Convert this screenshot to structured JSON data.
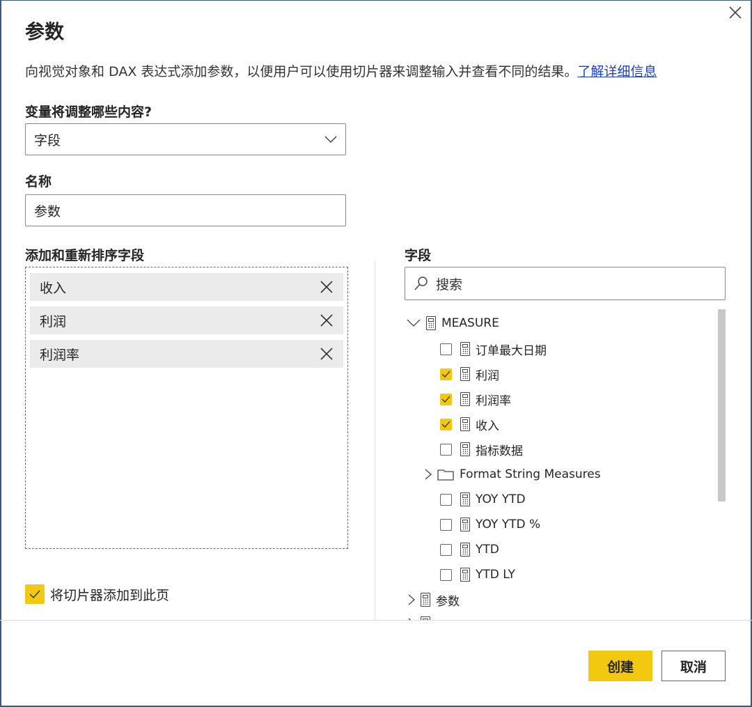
{
  "dialog": {
    "title": "参数",
    "description": "向视觉对象和 DAX 表达式添加参数，以便用户可以使用切片器来调整输入并查看不同的结果。",
    "learn_more": "了解详细信息"
  },
  "variable": {
    "label": "变量将调整哪些内容?",
    "value": "字段"
  },
  "name": {
    "label": "名称",
    "value": "参数"
  },
  "order": {
    "label": "添加和重新排序字段",
    "items": [
      "收入",
      "利润",
      "利润率"
    ]
  },
  "slicer": {
    "label": "将切片器添加到此页",
    "checked": true
  },
  "fields": {
    "label": "字段",
    "search_placeholder": "搜索",
    "group": "MEASURE",
    "items": [
      {
        "label": "订单最大日期",
        "checked": false
      },
      {
        "label": "利润",
        "checked": true
      },
      {
        "label": "利润率",
        "checked": true
      },
      {
        "label": "收入",
        "checked": true
      },
      {
        "label": "指标数据",
        "checked": false
      }
    ],
    "folder": "Format String Measures",
    "items2": [
      {
        "label": "YOY YTD",
        "checked": false
      },
      {
        "label": "YOY YTD %",
        "checked": false
      },
      {
        "label": "YTD",
        "checked": false
      },
      {
        "label": "YTD LY",
        "checked": false
      }
    ],
    "table2": "参数"
  },
  "buttons": {
    "create": "创建",
    "cancel": "取消"
  },
  "colors": {
    "accent": "#f2c811",
    "link": "#1a3fd6"
  }
}
